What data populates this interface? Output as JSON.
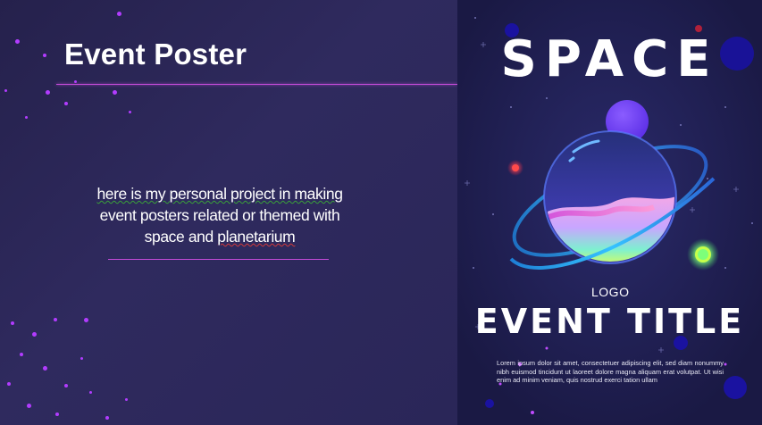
{
  "slide": {
    "title": "Event Poster",
    "body_line1": "here is my personal project in making",
    "body_line2": "event posters related or themed with",
    "body_line3_a": "space and ",
    "body_line3_b": "planetarium",
    "colors": {
      "accent": "#c34bd8",
      "dots": "#b23cff",
      "background": "#2a2655"
    }
  },
  "poster": {
    "heading": "SPACE",
    "logo": "LOGO",
    "event_title": "EVENT TITLE",
    "description": "Lorem ipsum dolor sit amet, consectetuer adipiscing elit, sed diam nonummy nibh euismod tincidunt ut laoreet dolore magna aliquam erat volutpat. Ut wisi enim ad minim veniam, quis nostrud exerci tation ullam",
    "colors": {
      "background": "#1c1b47",
      "planet_ring": "#2aa7e8",
      "moon": "#6a3df0"
    }
  }
}
